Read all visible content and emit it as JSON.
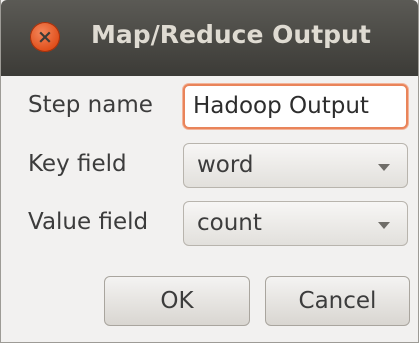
{
  "window": {
    "title": "Map/Reduce Output",
    "close_glyph": "×"
  },
  "form": {
    "step_name_label": "Step name",
    "step_name_value": "Hadoop Output",
    "key_field_label": "Key field",
    "key_field_value": "word",
    "value_field_label": "Value field",
    "value_field_value": "count"
  },
  "buttons": {
    "ok_label": "OK",
    "cancel_label": "Cancel"
  },
  "icons": {
    "close": "close-icon",
    "dropdown": "chevron-down-icon"
  },
  "colors": {
    "titlebar": "#3c3b37",
    "close_button": "#e9562a",
    "focus_border": "#e9845a",
    "dialog_background": "#f2f1f0"
  }
}
